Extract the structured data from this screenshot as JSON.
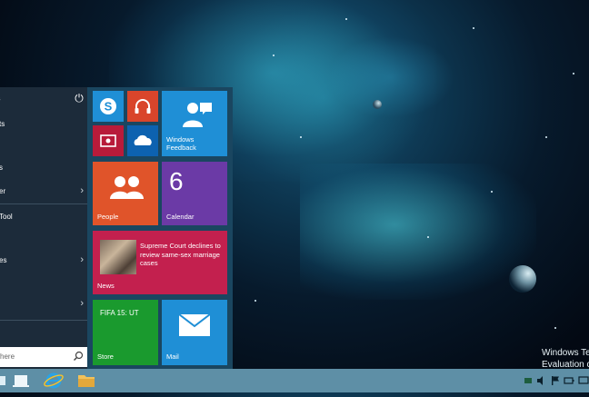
{
  "start_menu": {
    "user_name": "s",
    "left_items": [
      {
        "label": "ts",
        "arrow": false
      },
      {
        "label": "s",
        "arrow": false
      },
      {
        "label": "er",
        "arrow": true
      },
      {
        "label": "Tool",
        "arrow": false
      },
      {
        "label": "es",
        "arrow": true
      },
      {
        "label": "",
        "arrow": true
      }
    ],
    "search_placeholder": "here"
  },
  "tiles": {
    "feedback": "Windows\nFeedback",
    "people": "People",
    "calendar_day": "6",
    "calendar": "Calendar",
    "news_headline": "Supreme Court declines to review same-sex marriage cases",
    "news": "News",
    "store_game": "FIFA 15: UT",
    "store": "Store",
    "mail": "Mail"
  },
  "watermark": {
    "line1": "Windows Tec",
    "line2": "Evaluation co"
  },
  "colors": {
    "skype": "#1f8fd6",
    "music": "#d9452b",
    "video": "#b81b3a",
    "onedrive": "#0d62b0",
    "feedback": "#1f8fd6",
    "people": "#e0542a",
    "calendar": "#6b3aa6",
    "news": "#c3204e",
    "store": "#1a9a2e",
    "mail": "#1f8fd6",
    "taskbar": "#5e8fa6"
  }
}
